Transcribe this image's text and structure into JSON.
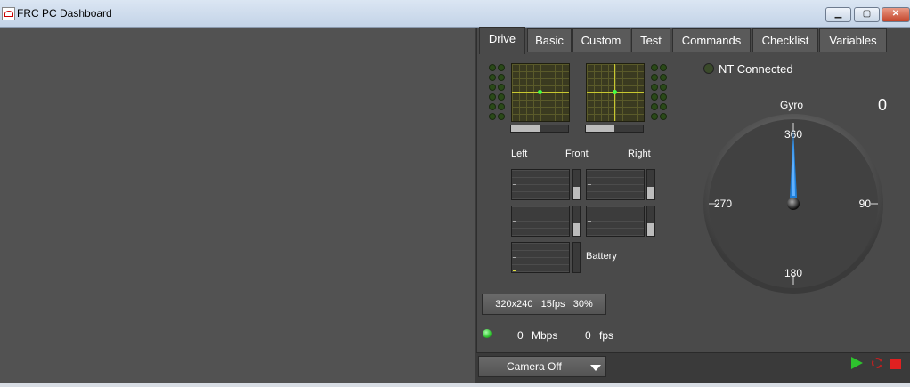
{
  "window": {
    "title": "FRC PC Dashboard",
    "minimize_label": "▁",
    "maximize_label": "▢",
    "close_label": "✕"
  },
  "tabs": [
    {
      "label": "Drive"
    },
    {
      "label": "Basic"
    },
    {
      "label": "Custom"
    },
    {
      "label": "Test"
    },
    {
      "label": "Commands"
    },
    {
      "label": "Checklist"
    },
    {
      "label": "Variables"
    }
  ],
  "drive": {
    "motor_labels": {
      "left": "Left",
      "front": "Front",
      "right": "Right"
    },
    "battery_label": "Battery",
    "joystick_left_slider": 0.5,
    "joystick_right_slider": 0.5
  },
  "status": {
    "nt_label": "NT Connected",
    "nt_connected": false
  },
  "gyro": {
    "title": "Gyro",
    "value": "0",
    "ticks": {
      "top": "360",
      "right": "90",
      "bottom": "180",
      "left": "270"
    },
    "angle": 0
  },
  "camera": {
    "settings_resolution": "320x240",
    "settings_fps": "15fps",
    "settings_quality": "30%",
    "bandwidth_value": "0",
    "bandwidth_unit": "Mbps",
    "fps_value": "0",
    "fps_unit": "fps",
    "select_value": "Camera Off"
  },
  "colors": {
    "accent_blue": "#1f7fd8",
    "play_green": "#2ec22e",
    "stop_red": "#e02020"
  },
  "icons": [
    "app-icon",
    "play-icon",
    "record-icon",
    "stop-icon",
    "dropdown-arrow-icon"
  ]
}
